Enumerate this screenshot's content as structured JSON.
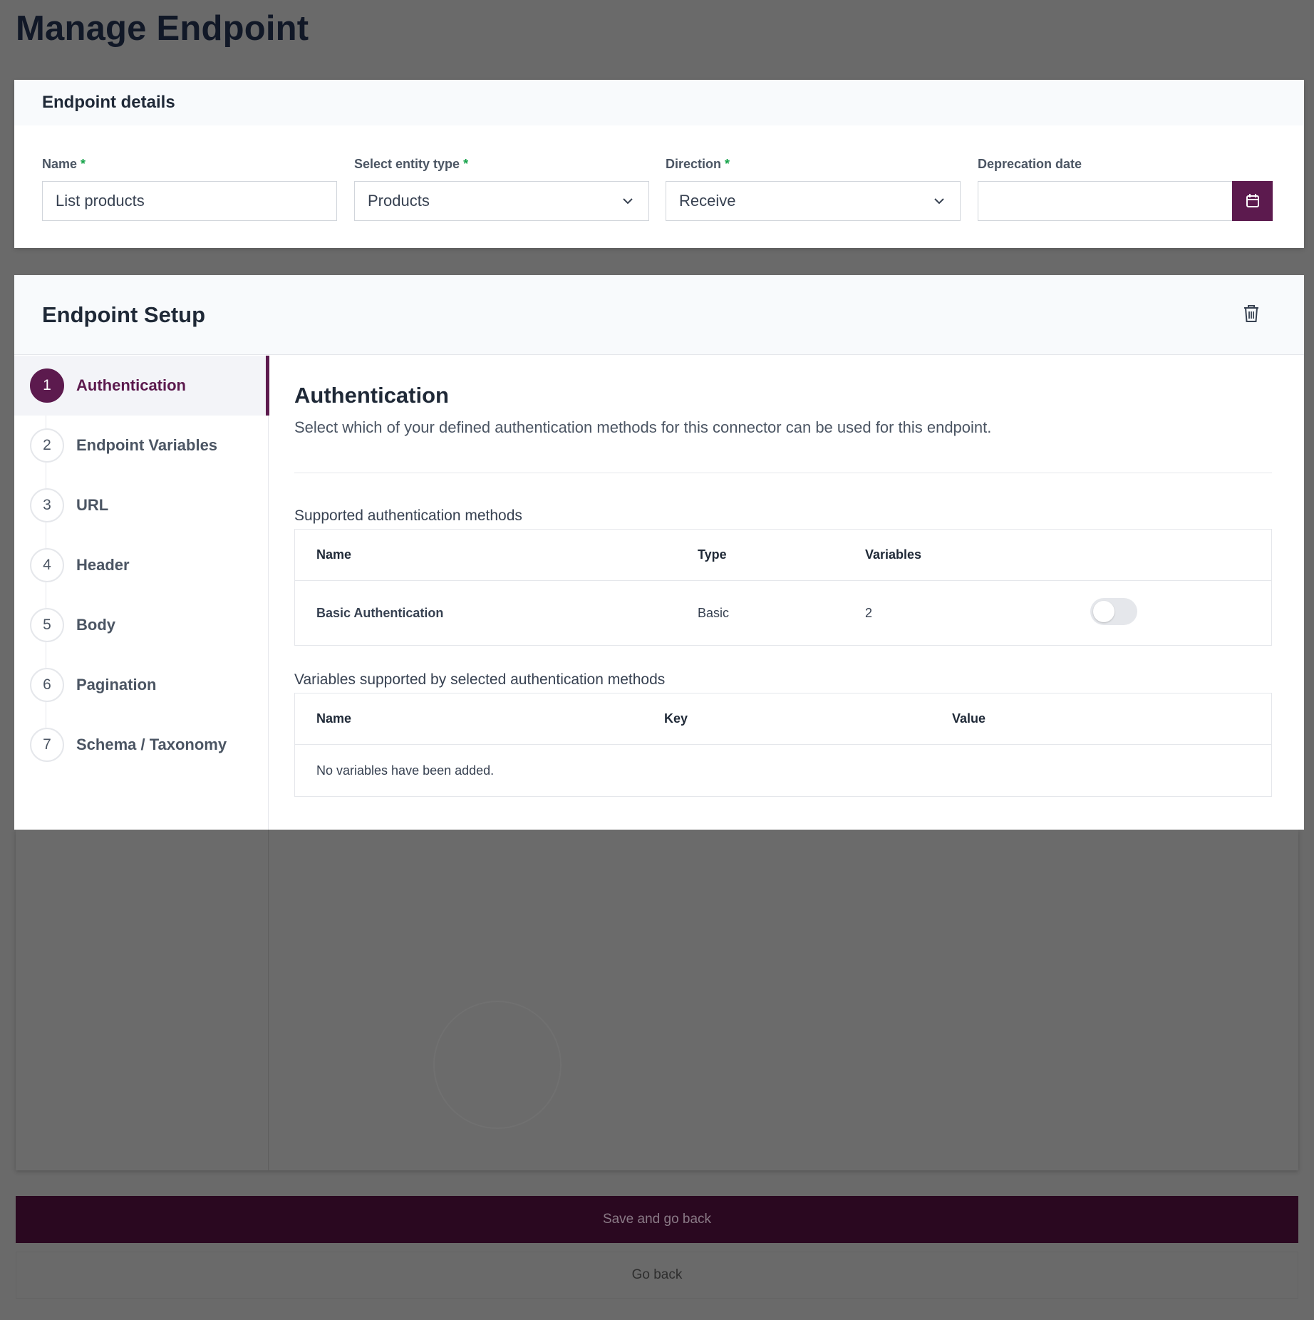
{
  "page": {
    "title": "Manage Endpoint"
  },
  "details": {
    "heading": "Endpoint details",
    "required_marker": "*",
    "name": {
      "label": "Name",
      "value": "List products"
    },
    "entity_type": {
      "label": "Select entity type",
      "value": "Products"
    },
    "direction": {
      "label": "Direction",
      "value": "Receive"
    },
    "deprecation": {
      "label": "Deprecation date",
      "value": ""
    }
  },
  "setup": {
    "heading": "Endpoint Setup",
    "steps": [
      {
        "num": "1",
        "label": "Authentication"
      },
      {
        "num": "2",
        "label": "Endpoint Variables"
      },
      {
        "num": "3",
        "label": "URL"
      },
      {
        "num": "4",
        "label": "Header"
      },
      {
        "num": "5",
        "label": "Body"
      },
      {
        "num": "6",
        "label": "Pagination"
      },
      {
        "num": "7",
        "label": "Schema / Taxonomy"
      }
    ],
    "active_step": 1,
    "auth": {
      "title": "Authentication",
      "description": "Select which of your defined authentication methods for this connector can be used for this endpoint.",
      "methods": {
        "title": "Supported authentication methods",
        "columns": [
          "Name",
          "Type",
          "Variables"
        ],
        "rows": [
          {
            "name": "Basic Authentication",
            "type": "Basic",
            "variables": "2",
            "enabled": false
          }
        ]
      },
      "variables": {
        "title": "Variables supported by selected authentication methods",
        "columns": [
          "Name",
          "Key",
          "Value"
        ],
        "empty_text": "No variables have been added."
      }
    }
  },
  "actions": {
    "save_label": "Save and go back",
    "back_label": "Go back"
  },
  "colors": {
    "accent": "#5c1a4e",
    "required": "#16a34a",
    "overlay": "#6a6a6a"
  }
}
